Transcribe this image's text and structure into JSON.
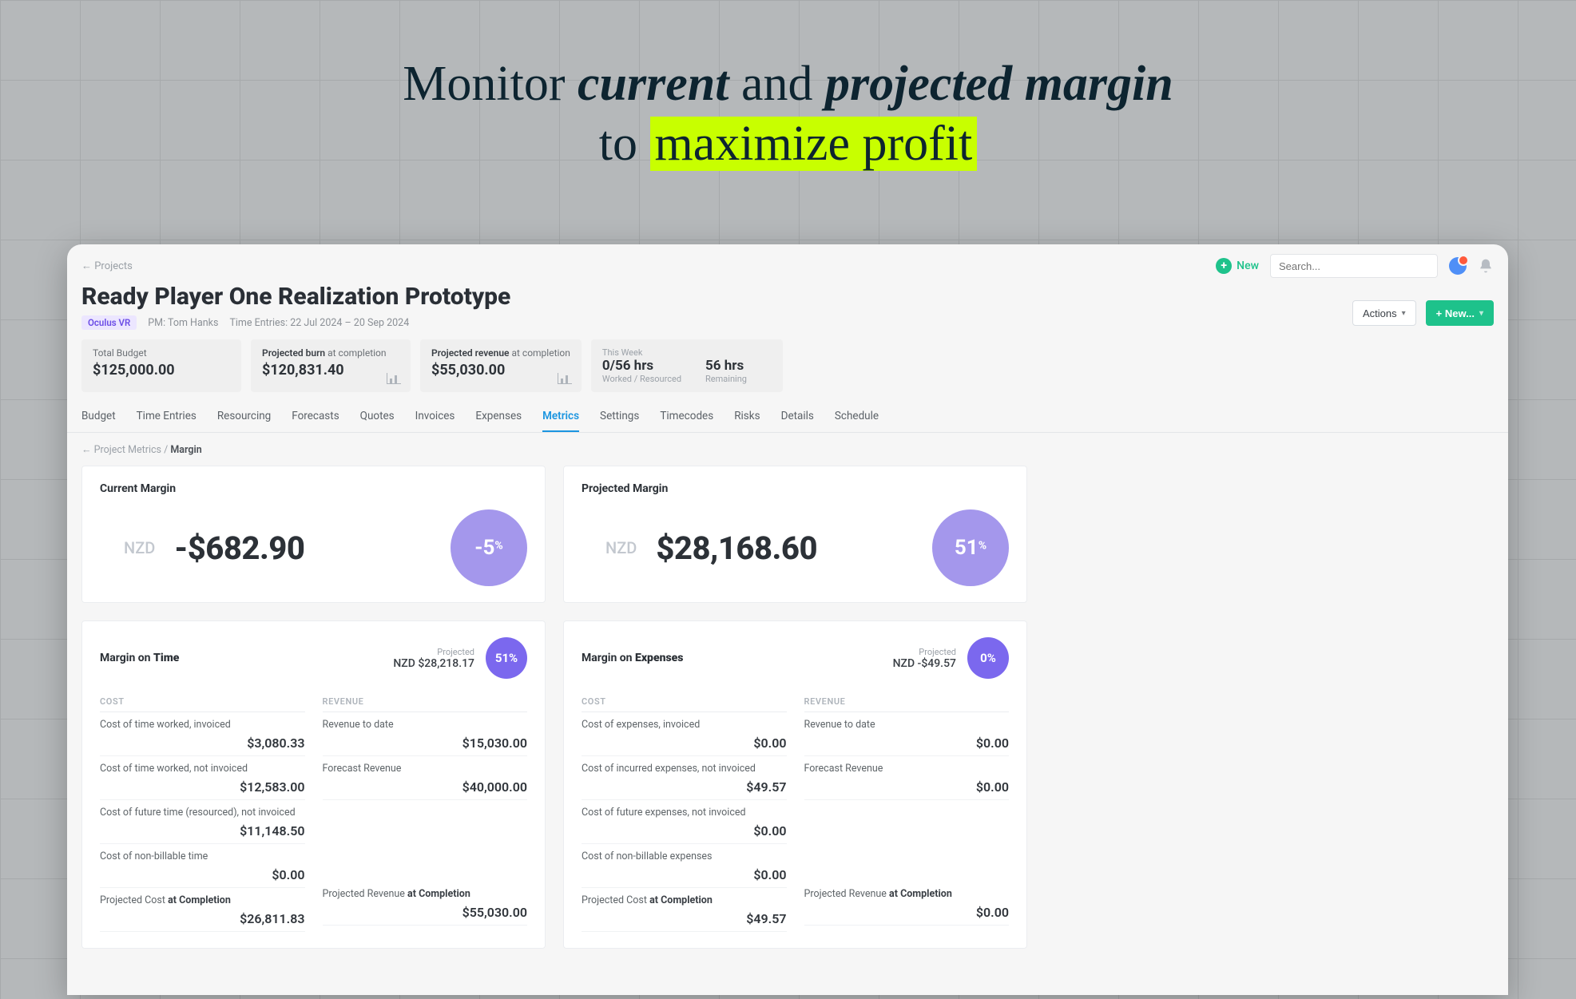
{
  "hero": {
    "l1a": "Monitor ",
    "l1b": "current",
    "l1c": " and ",
    "l1d": "projected margin",
    "l2a": "to ",
    "l2b": "maximize profit"
  },
  "back": "← Projects",
  "top": {
    "new": "New",
    "searchPlaceholder": "Search..."
  },
  "header": {
    "title": "Ready Player One Realization Prototype",
    "client": "Oculus VR",
    "pmLabel": "PM:",
    "pmName": "Tom Hanks",
    "timeLabel": "Time Entries:",
    "timeRange": "22 Jul 2024 – 20 Sep 2024",
    "actions": "Actions",
    "newBtn": "+ New..."
  },
  "stats": {
    "budgetLabel": "Total Budget",
    "budgetVal": "$125,000.00",
    "burnLabelA": "Projected burn",
    "burnLabelB": " at completion",
    "burnVal": "$120,831.40",
    "revLabelA": "Projected revenue",
    "revLabelB": " at completion",
    "revVal": "$55,030.00",
    "weekLabel": "This Week",
    "weekHrs": "0/56 hrs",
    "weekHrsSub": "Worked / Resourced",
    "weekRem": "56 hrs",
    "weekRemSub": "Remaining"
  },
  "tabs": [
    "Budget",
    "Time Entries",
    "Resourcing",
    "Forecasts",
    "Quotes",
    "Invoices",
    "Expenses",
    "Metrics",
    "Settings",
    "Timecodes",
    "Risks",
    "Details",
    "Schedule"
  ],
  "activeTab": 7,
  "crumb": {
    "a": "← Project Metrics",
    "sep": " / ",
    "b": "Margin"
  },
  "currentMargin": {
    "title": "Current Margin",
    "currency": "NZD",
    "amount": "-$682.90",
    "pct": "-5",
    "pctSuffix": "%"
  },
  "projectedMargin": {
    "title": "Projected Margin",
    "currency": "NZD",
    "amount": "$28,168.60",
    "pct": "51",
    "pctSuffix": "%"
  },
  "timeCard": {
    "titleA": "Margin on ",
    "titleB": "Time",
    "projLabel": "Projected",
    "projVal": "NZD $28,218.17",
    "pct": "51%",
    "costH": "COST",
    "revH": "REVENUE",
    "costRows": [
      {
        "l": "Cost of time worked, invoiced",
        "v": "$3,080.33"
      },
      {
        "l": "Cost of time worked, not invoiced",
        "v": "$12,583.00"
      },
      {
        "l": "Cost of future time (resourced), not invoiced",
        "v": "$11,148.50"
      },
      {
        "l": "Cost of non-billable time",
        "v": "$0.00"
      }
    ],
    "costTotal": {
      "la": "Projected Cost ",
      "lb": "at Completion",
      "v": "$26,811.83"
    },
    "revRows": [
      {
        "l": "Revenue to date",
        "v": "$15,030.00"
      },
      {
        "l": "Forecast Revenue",
        "v": "$40,000.00"
      }
    ],
    "revTotal": {
      "la": "Projected Revenue ",
      "lb": "at Completion",
      "v": "$55,030.00"
    }
  },
  "expCard": {
    "titleA": "Margin on ",
    "titleB": "Expenses",
    "projLabel": "Projected",
    "projVal": "NZD -$49.57",
    "pct": "0%",
    "costH": "COST",
    "revH": "REVENUE",
    "costRows": [
      {
        "l": "Cost of expenses, invoiced",
        "v": "$0.00"
      },
      {
        "l": "Cost of incurred expenses, not invoiced",
        "v": "$49.57"
      },
      {
        "l": "Cost of future expenses, not invoiced",
        "v": "$0.00"
      },
      {
        "l": "Cost of non-billable expenses",
        "v": "$0.00"
      }
    ],
    "costTotal": {
      "la": "Projected Cost ",
      "lb": "at Completion",
      "v": "$49.57"
    },
    "revRows": [
      {
        "l": "Revenue to date",
        "v": "$0.00"
      },
      {
        "l": "Forecast Revenue",
        "v": "$0.00"
      }
    ],
    "revTotal": {
      "la": "Projected Revenue ",
      "lb": "at Completion",
      "v": "$0.00"
    }
  }
}
